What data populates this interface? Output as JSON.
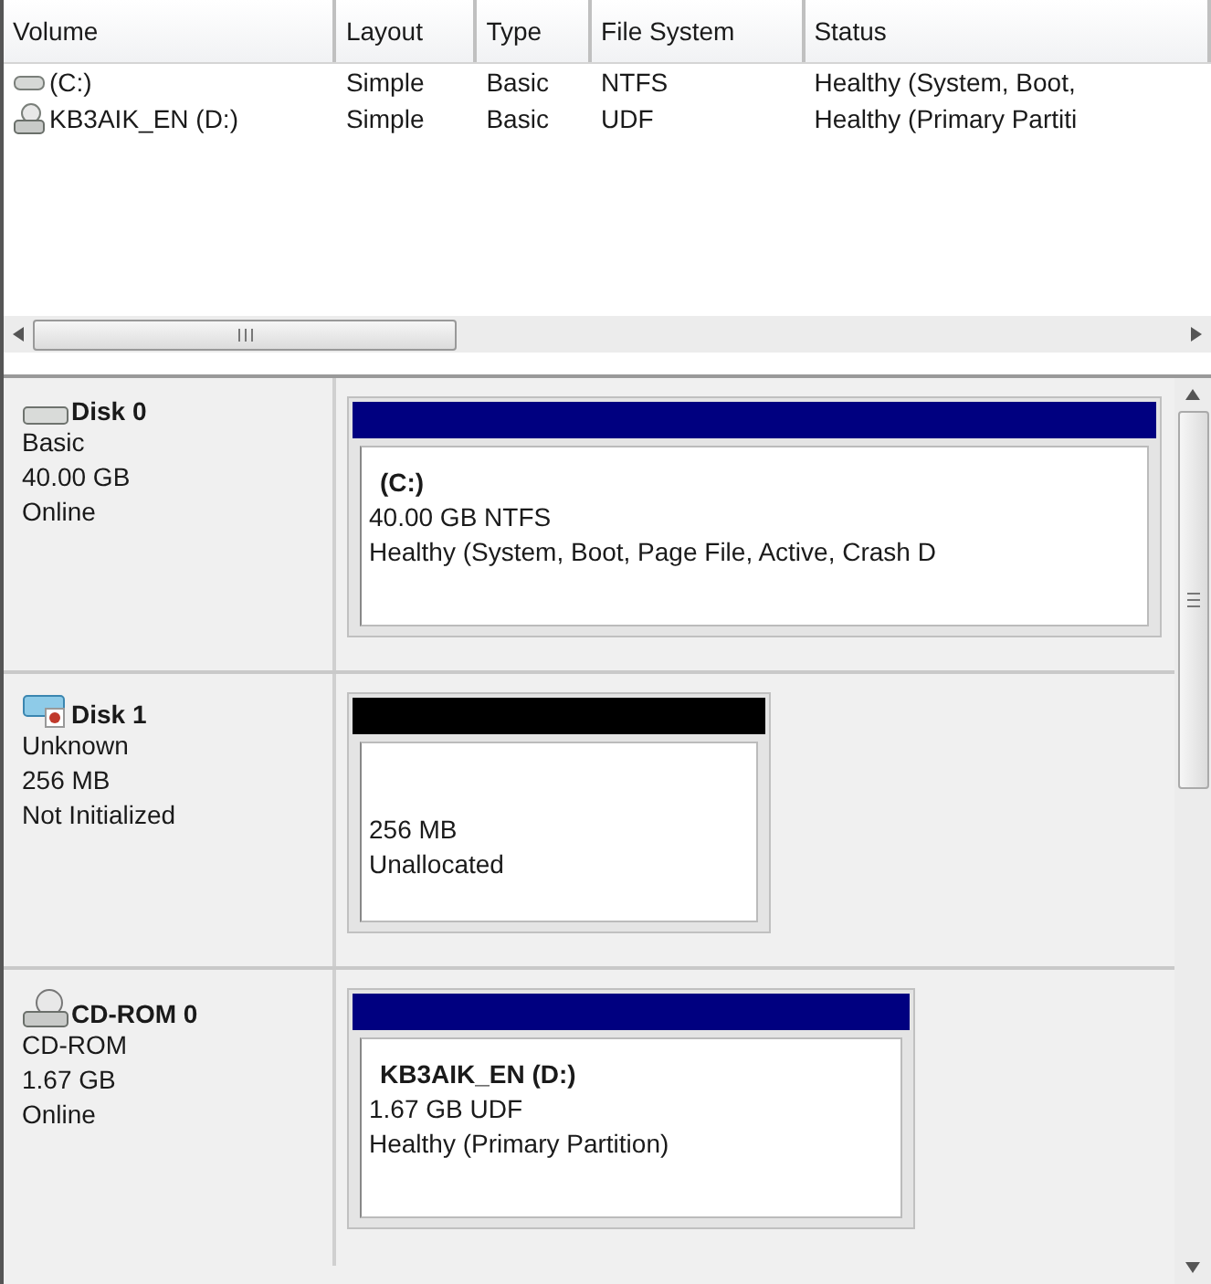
{
  "volume_list": {
    "columns": [
      "Volume",
      "Layout",
      "Type",
      "File System",
      "Status"
    ],
    "rows": [
      {
        "kind": "hdd",
        "cells": [
          "(C:)",
          "Simple",
          "Basic",
          "NTFS",
          "Healthy (System, Boot,"
        ]
      },
      {
        "kind": "cdrom",
        "cells": [
          "KB3AIK_EN (D:)",
          "Simple",
          "Basic",
          "UDF",
          "Healthy (Primary Partiti"
        ]
      }
    ]
  },
  "disks": [
    {
      "kind": "hdd",
      "name": "Disk 0",
      "lines": [
        "Basic",
        "40.00 GB",
        "Online"
      ],
      "partitions": [
        {
          "color": "#000080",
          "title": "(C:)",
          "lines": [
            "40.00 GB NTFS",
            "Healthy (System, Boot, Page File, Active, Crash D"
          ]
        }
      ]
    },
    {
      "kind": "unknown",
      "name": "Disk 1",
      "lines": [
        "Unknown",
        "256 MB",
        "Not Initialized"
      ],
      "partitions": [
        {
          "color": "#000000",
          "lines": [
            "256 MB",
            "Unallocated"
          ]
        }
      ]
    },
    {
      "kind": "cdrom",
      "name": "CD-ROM 0",
      "lines": [
        "CD-ROM",
        "1.67 GB",
        "Online"
      ],
      "partitions": [
        {
          "color": "#000080",
          "title": "KB3AIK_EN  (D:)",
          "lines": [
            "1.67 GB UDF",
            "Healthy (Primary Partition)"
          ]
        }
      ]
    }
  ]
}
